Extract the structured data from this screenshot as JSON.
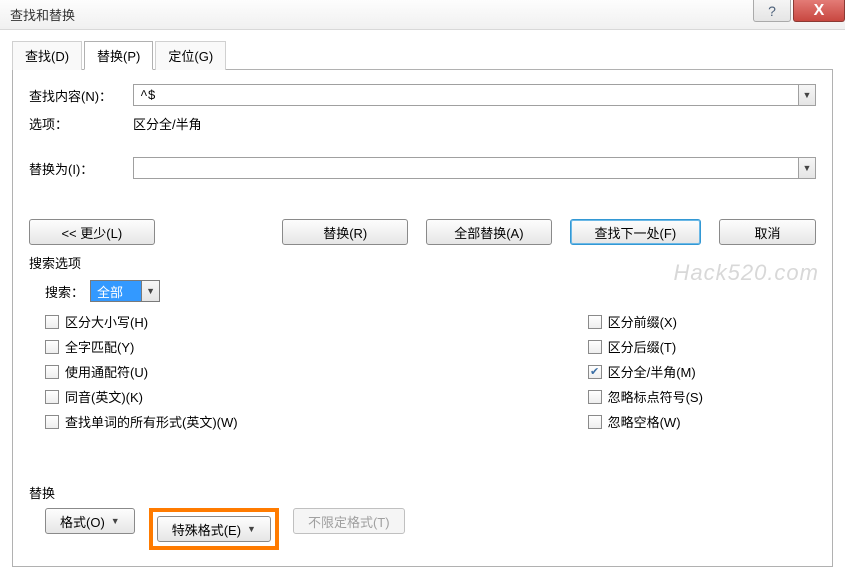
{
  "window": {
    "title": "查找和替换",
    "help_icon": "?",
    "close_icon": "X"
  },
  "tabs": {
    "find": "查找(D)",
    "replace": "替换(P)",
    "goto": "定位(G)"
  },
  "fields": {
    "find_label": "查找内容(N)：",
    "find_value": "^$",
    "options_label": "选项：",
    "options_value": "区分全/半角",
    "replace_label": "替换为(I)：",
    "replace_value": ""
  },
  "buttons": {
    "less": "<< 更少(L)",
    "replace": "替换(R)",
    "replace_all": "全部替换(A)",
    "find_next": "查找下一处(F)",
    "cancel": "取消"
  },
  "search_opts": {
    "heading": "搜索选项",
    "search_label": "搜索：",
    "search_value": "全部",
    "left": [
      {
        "label": "区分大小写(H)",
        "checked": false
      },
      {
        "label": "全字匹配(Y)",
        "checked": false
      },
      {
        "label": "使用通配符(U)",
        "checked": false
      },
      {
        "label": "同音(英文)(K)",
        "checked": false
      },
      {
        "label": "查找单词的所有形式(英文)(W)",
        "checked": false
      }
    ],
    "right": [
      {
        "label": "区分前缀(X)",
        "checked": false
      },
      {
        "label": "区分后缀(T)",
        "checked": false
      },
      {
        "label": "区分全/半角(M)",
        "checked": true
      },
      {
        "label": "忽略标点符号(S)",
        "checked": false
      },
      {
        "label": "忽略空格(W)",
        "checked": false
      }
    ]
  },
  "bottom": {
    "heading": "替换",
    "format": "格式(O)",
    "special": "特殊格式(E)",
    "noformat": "不限定格式(T)"
  },
  "watermark": "Hack520.com"
}
